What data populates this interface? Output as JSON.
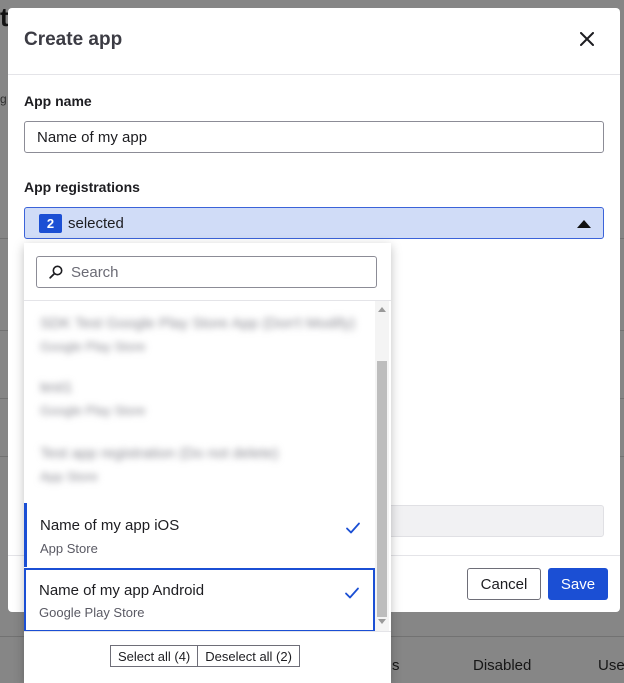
{
  "background": {
    "logo": "t",
    "side_text": "g",
    "cells": [
      "s",
      "Disabled",
      "Use"
    ]
  },
  "modal": {
    "title": "Create app",
    "app_name_label": "App name",
    "app_name_value": "Name of my app",
    "registrations_label": "App registrations",
    "selected_count": "2",
    "selected_text": "selected",
    "cancel_label": "Cancel",
    "save_label": "Save"
  },
  "dropdown": {
    "search_placeholder": "Search",
    "items": [
      {
        "title": "SDK Test Google Play Store App (Don't Modify)",
        "subtitle": "Google Play Store",
        "selected": false,
        "blurred": true
      },
      {
        "title": "test1",
        "subtitle": "Google Play Store",
        "selected": false,
        "blurred": true
      },
      {
        "title": "Test app registration (Do not delete)",
        "subtitle": "App Store",
        "selected": false,
        "blurred": true
      },
      {
        "title": "Name of my app iOS",
        "subtitle": "App Store",
        "selected": true,
        "blurred": false
      },
      {
        "title": "Name of my app Android",
        "subtitle": "Google Play Store",
        "selected": true,
        "blurred": false
      }
    ],
    "select_all_label": "Select all (4)",
    "deselect_all_label": "Deselect all (2)"
  },
  "colors": {
    "accent": "#1b4fd4",
    "select_bg": "#d0dcf7"
  }
}
